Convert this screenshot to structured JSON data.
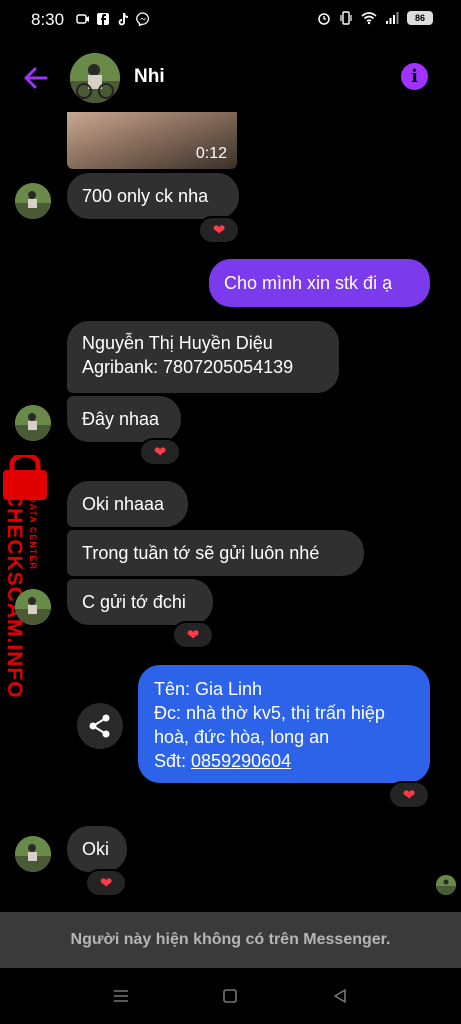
{
  "status_bar": {
    "time": "8:30",
    "battery": "86"
  },
  "header": {
    "contact_name": "Nhi",
    "info_glyph": "i"
  },
  "video": {
    "duration": "0:12"
  },
  "messages": {
    "m1": "700 only ck nha",
    "m2": "Cho mình xin stk đi ạ",
    "m3_line1": "Nguyễn Thị Huyền Diệu",
    "m3_line2": "Agribank: 7807205054139",
    "m4": "Đây nhaa",
    "m5": "Oki nhaaa",
    "m6": "Trong tuần tớ sẽ gửi luôn nhé",
    "m7": "C gửi tớ đchi",
    "m8_line1": "Tên: Gia Linh",
    "m8_line2": "Đc: nhà thờ kv5, thị trấn hiệp",
    "m8_line3": "hoà, đức hòa, long an",
    "m8_line4_prefix": "Sđt: ",
    "m8_phone": "0859290604",
    "m9": "Oki"
  },
  "reaction_glyph": "❤",
  "watermark": {
    "small": "DATA CENTER",
    "large": "CHECKSCAM.INFO"
  },
  "notice": "Người này hiện không có trên Messenger.",
  "colors": {
    "accent": "#a033ff",
    "outgoing_purple": "#7c3aed",
    "outgoing_blue": "#2c63e8",
    "incoming": "#303030",
    "watermark_red": "#e00000",
    "heart": "#ff3b4a"
  },
  "icons": [
    "video-camera-icon",
    "facebook-icon",
    "tiktok-icon",
    "messenger-icon",
    "alarm-icon",
    "vibrate-icon",
    "wifi-icon",
    "signal-icon",
    "battery-icon",
    "back-arrow-icon",
    "info-icon",
    "share-icon",
    "heart-icon",
    "lock-icon",
    "nav-menu-icon",
    "nav-home-icon",
    "nav-back-icon"
  ]
}
